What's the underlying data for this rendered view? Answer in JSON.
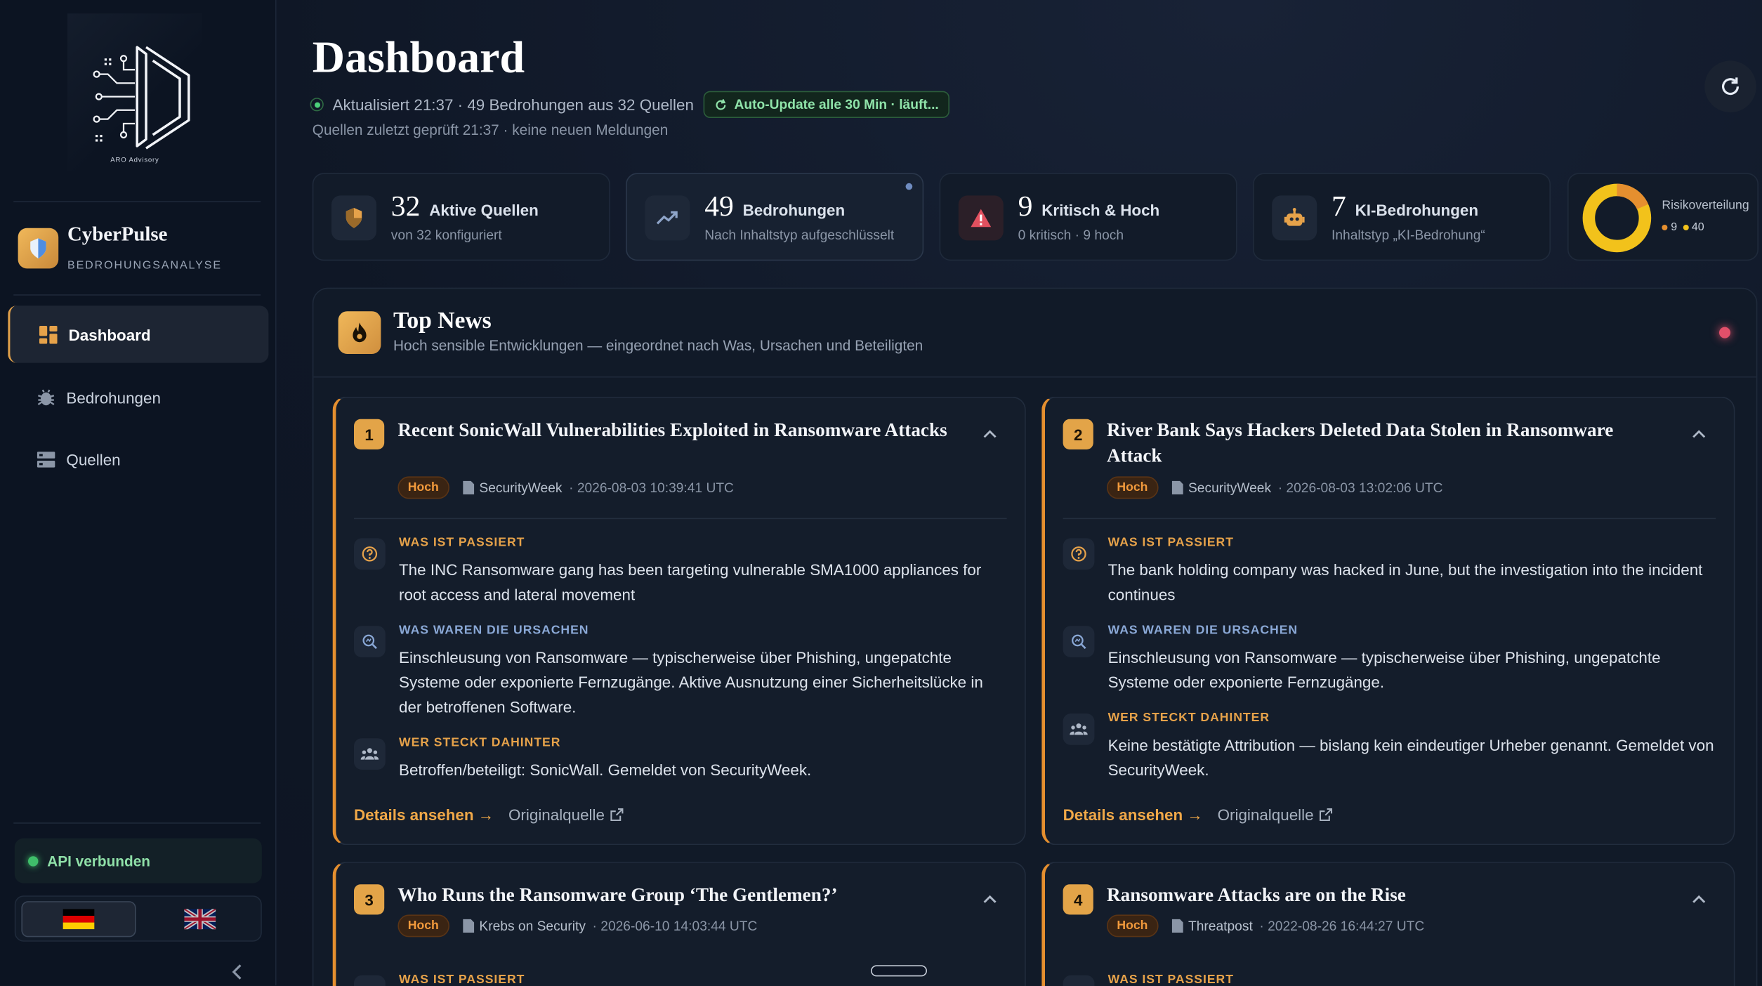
{
  "logo": {
    "text": "ARO Advisory"
  },
  "brand": {
    "name": "CyberPulse",
    "subtitle": "BEDROHUNGSANALYSE"
  },
  "nav": [
    {
      "label": "Dashboard",
      "icon": "dashboard-grid-icon",
      "active": true
    },
    {
      "label": "Bedrohungen",
      "icon": "bug-icon",
      "active": false
    },
    {
      "label": "Quellen",
      "icon": "server-icon",
      "active": false
    }
  ],
  "api": {
    "label": "API verbunden"
  },
  "language": {
    "options": [
      "de",
      "en"
    ],
    "selected": "de"
  },
  "header": {
    "title": "Dashboard",
    "updated": "Aktualisiert 21:37 · 49 Bedrohungen aus 32 Quellen",
    "auto_update": "Auto-Update alle 30 Min · läuft...",
    "checked": "Quellen zuletzt geprüft 21:37 · keine neuen Meldungen"
  },
  "stats": [
    {
      "value": "32",
      "label": "Aktive Quellen",
      "sub": "von 32 konfiguriert",
      "icon": "shield-icon"
    },
    {
      "value": "49",
      "label": "Bedrohungen",
      "sub": "Nach Inhaltstyp aufgeschlüsselt",
      "icon": "trend-up-icon"
    },
    {
      "value": "9",
      "label": "Kritisch & Hoch",
      "sub": "0 kritisch · 9 hoch",
      "icon": "warning-icon"
    },
    {
      "value": "7",
      "label": "KI-Bedrohungen",
      "sub": "Inhaltstyp „KI-Bedrohung“",
      "icon": "robot-icon"
    }
  ],
  "risk": {
    "label": "Risikoverteilung",
    "legend": [
      {
        "value": "9",
        "color": "#e58f2f"
      },
      {
        "value": "40",
        "color": "#f2c21b"
      }
    ]
  },
  "top_news": {
    "title": "Top News",
    "subtitle": "Hoch sensible Entwicklungen — eingeordnet nach Was, Ursachen und Beteiligten",
    "section_labels": {
      "what": "WAS IST PASSIERT",
      "why": "WAS WAREN DIE URSACHEN",
      "who": "WER STECKT DAHINTER"
    },
    "details_label": "Details ansehen →",
    "source_label": "Originalquelle",
    "items": [
      {
        "num": "1",
        "title": "Recent SonicWall Vulnerabilities Exploited in Ransomware Attacks",
        "badge": "Hoch",
        "source": "SecurityWeek",
        "date": "· 2026-08-03 10:39:41 UTC",
        "what": "The INC Ransomware gang has been targeting vulnerable SMA1000 appliances for root access and lateral movement",
        "why": "Einschleusung von Ransomware — typischerweise über Phishing, ungepatchte Systeme oder exponierte Fernzugänge. Aktive Ausnutzung einer Sicherheitslücke in der betroffenen Software.",
        "who": "Betroffen/beteiligt: SonicWall. Gemeldet von SecurityWeek."
      },
      {
        "num": "2",
        "title": "River Bank Says Hackers Deleted Data Stolen in Ransomware Attack",
        "badge": "Hoch",
        "source": "SecurityWeek",
        "date": "· 2026-08-03 13:02:06 UTC",
        "what": "The bank holding company was hacked in June, but the investigation into the incident continues",
        "why": "Einschleusung von Ransomware — typischerweise über Phishing, ungepatchte Systeme oder exponierte Fernzugänge.",
        "who": "Keine bestätigte Attribution — bislang kein eindeutiger Urheber genannt. Gemeldet von SecurityWeek."
      },
      {
        "num": "3",
        "title": "Who Runs the Ransomware Group ‘The Gentlemen?’",
        "badge": "Hoch",
        "source": "Krebs on Security",
        "date": "· 2026-06-10 14:03:44 UTC"
      },
      {
        "num": "4",
        "title": "Ransomware Attacks are on the Rise",
        "badge": "Hoch",
        "source": "Threatpost",
        "date": "· 2022-08-26 16:44:27 UTC"
      }
    ]
  }
}
